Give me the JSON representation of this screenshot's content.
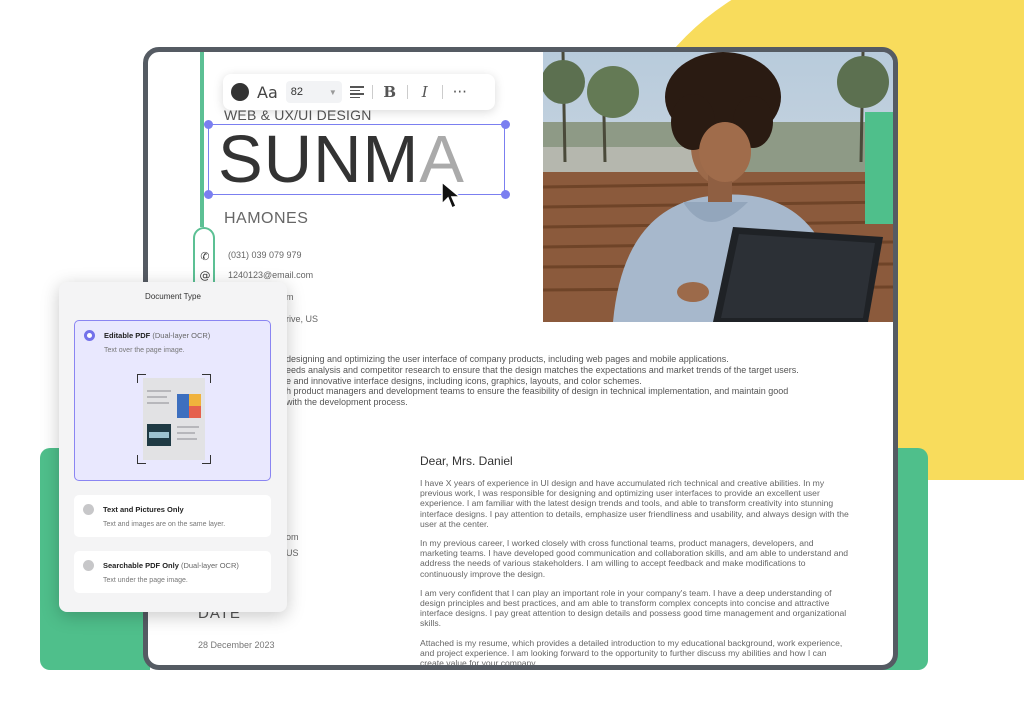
{
  "toolbar": {
    "text_color": "#333333",
    "font_icon": "Aa",
    "font_size": "82",
    "align_icon": "align-left-icon",
    "bold_label": "B",
    "italic_label": "I",
    "more_label": "···"
  },
  "resume": {
    "subtitle": "WEB & UX/UI DESIGN",
    "first_name_main": "SUNM",
    "first_name_last": "A",
    "last_name": "HAMONES",
    "phone": "(031) 039 079 979",
    "email": "1240123@email.com",
    "contact_partial_1": "m",
    "contact_partial_2": "rive, US",
    "experience_lines": [
      "designing and optimizing the user interface of company products, including web pages and mobile applications.",
      "eeds analysis and competitor research to ensure that the design matches the expectations and market trends of the target users.",
      "e and innovative interface designs, including icons, graphics, layouts, and color schemes.",
      "h product managers and development teams to ensure the feasibility of design in technical implementation, and maintain good",
      "with the development process."
    ],
    "lower_partial_1": "om",
    "lower_partial_2": "US",
    "date_label": "DATE",
    "date_value": "28 December 2023"
  },
  "letter": {
    "greeting": "Dear, Mrs. Daniel",
    "paragraphs": [
      "I have X years of experience in UI design and have accumulated rich technical and creative abilities. In my previous work, I was responsible for designing and optimizing user interfaces to provide an excellent user experience. I am familiar with the latest design trends and tools, and able to transform creativity into stunning interface designs. I pay attention to details, emphasize user friendliness and usability, and always design with the user at the center.",
      "In my previous career, I worked closely with cross functional teams, product managers, developers, and marketing teams. I have developed good communication and collaboration skills, and am able to understand and address the needs of various stakeholders. I am willing to accept feedback and make modifications to continuously improve the design.",
      "I am very confident that I can play an important role in your company's team. I have a deep understanding of design principles and best practices, and am able to transform complex concepts into concise and attractive interface designs. I pay great attention to design details and possess good time management and organizational skills.",
      "Attached is my resume, which provides a detailed introduction to my educational background, work experience, and project experience. I am looking forward to the opportunity to further discuss my abilities and how I can create value for your company."
    ]
  },
  "dialog": {
    "title": "Document Type",
    "options": [
      {
        "title": "Editable PDF",
        "subtitle": "(Dual-layer OCR)",
        "desc": "Text over the page image.",
        "selected": true
      },
      {
        "title": "Text and Pictures Only",
        "subtitle": "",
        "desc": "Text and images are on the same layer.",
        "selected": false
      },
      {
        "title": "Searchable PDF Only",
        "subtitle": "(Dual-layer OCR)",
        "desc": "Text under the page image.",
        "selected": false
      }
    ]
  },
  "colors": {
    "accent_purple": "#7371ea",
    "brand_green": "#4fbf8b",
    "brand_yellow": "#f8dc5c"
  }
}
